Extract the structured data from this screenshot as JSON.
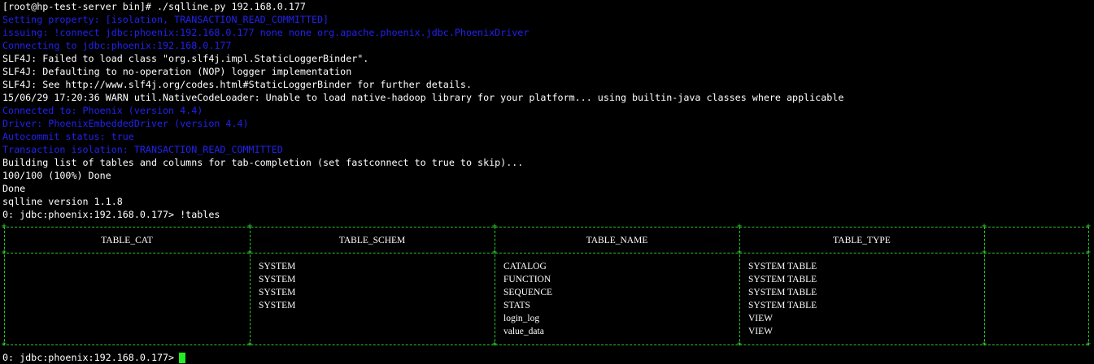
{
  "terminal": {
    "lines": [
      {
        "text": "[root@hp-test-server bin]# ./sqlline.py 192.168.0.177",
        "color": "#ffffff"
      },
      {
        "text": "Setting property: [isolation, TRANSACTION_READ_COMMITTED]",
        "color": "#2222ee"
      },
      {
        "text": "issuing: !connect jdbc:phoenix:192.168.0.177 none none org.apache.phoenix.jdbc.PhoenixDriver",
        "color": "#2222ee"
      },
      {
        "text": "Connecting to jdbc:phoenix:192.168.0.177",
        "color": "#2222ee"
      },
      {
        "text": "SLF4J: Failed to load class \"org.slf4j.impl.StaticLoggerBinder\".",
        "color": "#ffffff"
      },
      {
        "text": "SLF4J: Defaulting to no-operation (NOP) logger implementation",
        "color": "#ffffff"
      },
      {
        "text": "SLF4J: See http://www.slf4j.org/codes.html#StaticLoggerBinder for further details.",
        "color": "#ffffff"
      },
      {
        "text": "15/06/29 17:20:36 WARN util.NativeCodeLoader: Unable to load native-hadoop library for your platform... using builtin-java classes where applicable",
        "color": "#ffffff"
      },
      {
        "text": "Connected to: Phoenix (version 4.4)",
        "color": "#2222ee"
      },
      {
        "text": "Driver: PhoenixEmbeddedDriver (version 4.4)",
        "color": "#2222ee"
      },
      {
        "text": "Autocommit status: true",
        "color": "#2222ee"
      },
      {
        "text": "Transaction isolation: TRANSACTION_READ_COMMITTED",
        "color": "#2222ee"
      },
      {
        "text": "Building list of tables and columns for tab-completion (set fastconnect to true to skip)...",
        "color": "#ffffff"
      },
      {
        "text": "100/100 (100%) Done",
        "color": "#ffffff"
      },
      {
        "text": "Done",
        "color": "#ffffff"
      },
      {
        "text": "sqlline version 1.1.8",
        "color": "#ffffff"
      },
      {
        "text": "0: jdbc:phoenix:192.168.0.177> !tables",
        "color": "#ffffff"
      }
    ],
    "table": {
      "headers": [
        "TABLE_CAT",
        "TABLE_SCHEM",
        "TABLE_NAME",
        "TABLE_TYPE",
        ""
      ],
      "rows": [
        [
          "",
          "SYSTEM",
          "CATALOG",
          "SYSTEM TABLE",
          ""
        ],
        [
          "",
          "SYSTEM",
          "FUNCTION",
          "SYSTEM TABLE",
          ""
        ],
        [
          "",
          "SYSTEM",
          "SEQUENCE",
          "SYSTEM TABLE",
          ""
        ],
        [
          "",
          "SYSTEM",
          "STATS",
          "SYSTEM TABLE",
          ""
        ],
        [
          "",
          "",
          "login_log",
          "VIEW",
          ""
        ],
        [
          "",
          "",
          "value_data",
          "VIEW",
          ""
        ]
      ],
      "border_color": "#2ec62e"
    },
    "prompt": "0: jdbc:phoenix:192.168.0.177>",
    "cursor_color": "#22ee22"
  }
}
